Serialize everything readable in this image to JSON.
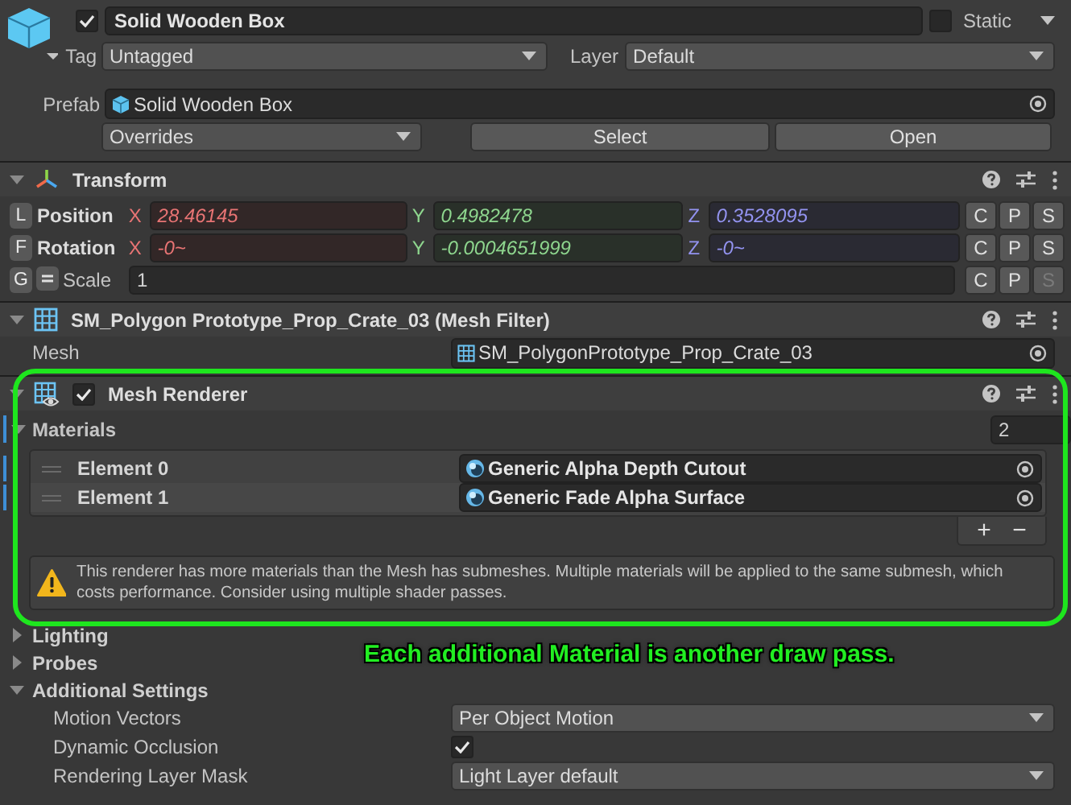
{
  "object": {
    "active": true,
    "name": "Solid Wooden Box",
    "static": false,
    "static_label": "Static",
    "tag_label": "Tag",
    "tag": "Untagged",
    "layer_label": "Layer",
    "layer": "Default"
  },
  "prefab": {
    "label": "Prefab",
    "asset": "Solid Wooden Box",
    "overrides": "Overrides",
    "buttons": [
      "Select",
      "Open"
    ]
  },
  "transform": {
    "title": "Transform",
    "expanded": true,
    "rows": [
      {
        "key": "L",
        "label": "Position",
        "kind": "vector",
        "fields": [
          {
            "axis": "X",
            "value": "28.46145",
            "color": "#e87474"
          },
          {
            "axis": "Y",
            "value": "0.4982478",
            "color": "#8ed68e"
          },
          {
            "axis": "Z",
            "value": "0.3528095",
            "color": "#9393f0"
          }
        ],
        "buttons": [
          {
            "label": "C",
            "disabled": false
          },
          {
            "label": "P",
            "disabled": false
          },
          {
            "label": "S",
            "disabled": false
          }
        ]
      },
      {
        "key": "F",
        "label": "Rotation",
        "kind": "vector",
        "fields": [
          {
            "axis": "X",
            "value": "-0~",
            "color": "#e87474"
          },
          {
            "axis": "Y",
            "value": "-0.0004651999",
            "color": "#8ed68e"
          },
          {
            "axis": "Z",
            "value": "-0~",
            "color": "#9393f0"
          }
        ],
        "buttons": [
          {
            "label": "C",
            "disabled": false
          },
          {
            "label": "P",
            "disabled": false
          },
          {
            "label": "S",
            "disabled": false
          }
        ]
      },
      {
        "key": "G",
        "label": "Scale",
        "kind": "uniform",
        "value": "1",
        "buttons": [
          {
            "label": "C",
            "disabled": false
          },
          {
            "label": "P",
            "disabled": false
          },
          {
            "label": "S",
            "disabled": true
          }
        ]
      }
    ]
  },
  "mesh_filter": {
    "title": "SM_Polygon Prototype_Prop_Crate_03 (Mesh Filter)",
    "expanded": true,
    "mesh_label": "Mesh",
    "mesh": "SM_PolygonPrototype_Prop_Crate_03"
  },
  "mesh_renderer": {
    "title": "Mesh Renderer",
    "enabled": true,
    "expanded": true,
    "materials_label": "Materials",
    "materials_expanded": true,
    "materials_overridden": true,
    "materials_count": "2",
    "elements": [
      {
        "label": "Element 0",
        "material": "Generic Alpha Depth Cutout",
        "overridden": true
      },
      {
        "label": "Element 1",
        "material": "Generic Fade Alpha Surface",
        "overridden": true
      }
    ],
    "add": "+",
    "remove": "−",
    "warning": "This renderer has more materials than the Mesh has submeshes. Multiple materials will be applied to the same submesh, which costs performance. Consider using multiple shader passes.",
    "sections": [
      {
        "label": "Lighting",
        "expanded": false
      },
      {
        "label": "Probes",
        "expanded": false
      },
      {
        "label": "Additional Settings",
        "expanded": true
      }
    ],
    "settings": [
      {
        "kind": "dropdown",
        "label": "Motion Vectors",
        "value": "Per Object Motion"
      },
      {
        "kind": "checkbox",
        "label": "Dynamic Occlusion",
        "checked": true
      },
      {
        "kind": "dropdown",
        "label": "Rendering Layer Mask",
        "value": "Light Layer default"
      }
    ]
  },
  "annotation": {
    "text": "Each additional Material is another draw pass."
  }
}
